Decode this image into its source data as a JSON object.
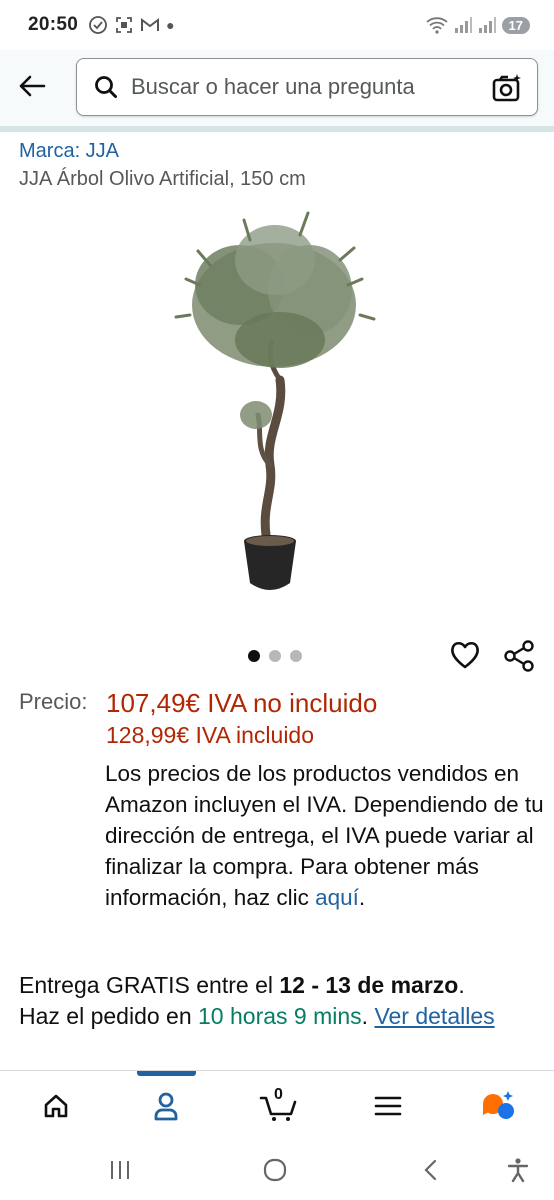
{
  "status_bar": {
    "time": "20:50",
    "battery": "17"
  },
  "header": {
    "search_placeholder": "Buscar o hacer una pregunta"
  },
  "product": {
    "brand": "Marca: JJA",
    "title": "JJA Árbol Olivo Artificial, 150 cm",
    "image_count": 3,
    "active_image": 1
  },
  "price": {
    "label": "Precio:",
    "main": "107,49€ IVA no incluido",
    "with_vat": "128,99€ IVA incluido",
    "note": "Los precios de los productos vendidos en Amazon incluyen el IVA. Dependiendo de tu dirección de entrega, el IVA puede variar al finalizar la compra. Para obtener más información, haz clic ",
    "note_link": "aquí",
    "note_end": "."
  },
  "delivery": {
    "prefix": "Entrega GRATIS entre el ",
    "dates": "12 - 13 de marzo",
    "suffix": ".",
    "order_prefix": "Haz el pedido en ",
    "countdown": "10 horas 9 mins",
    "order_suffix": ". ",
    "details_link": "Ver detalles"
  },
  "bottom_nav": {
    "cart_count": "0",
    "items": [
      "home-icon",
      "account-icon",
      "cart-icon",
      "menu-icon",
      "rufus-icon"
    ]
  },
  "colors": {
    "link": "#2162a1",
    "price": "#b12704",
    "countdown": "#067d62"
  }
}
